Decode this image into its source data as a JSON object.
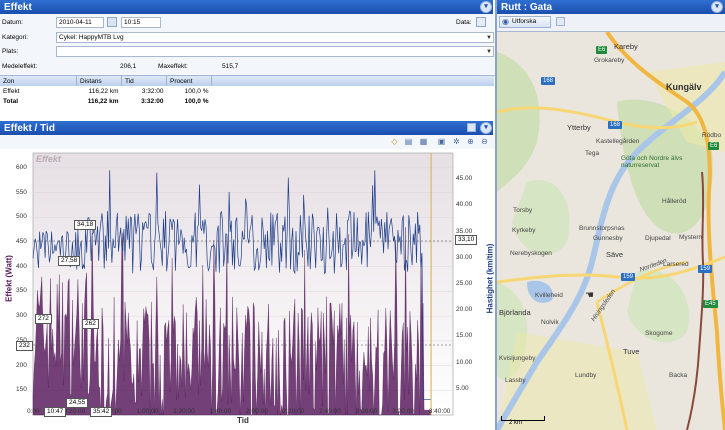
{
  "effekt_panel": {
    "title": "Effekt",
    "datum_label": "Datum:",
    "datum_value": "2010-04-11",
    "time_value": "10:15",
    "data_label": "Data:",
    "kategori_label": "Kategori:",
    "kategori_value": "Cykel: HappyMTB Lvg",
    "plats_label": "Plats:",
    "plats_value": "",
    "medel_label": "Medeleffekt:",
    "medel_value": "206,1",
    "max_label": "Maxeffekt:",
    "max_value": "515,7",
    "zone_table": {
      "headers": [
        "Zon",
        "Distans",
        "Tid",
        "Procent"
      ],
      "rows": [
        [
          "Effekt",
          "116,22 km",
          "3:32:00",
          "100,0 %"
        ],
        [
          "Total",
          "116,22 km",
          "3:32:00",
          "100,0 %"
        ]
      ]
    }
  },
  "chart_panel": {
    "title": "Effekt / Tid",
    "chart_watermark": "Effekt"
  },
  "chart_data": {
    "type": "line",
    "title": "",
    "xlabel": "Tid",
    "ylabel": "Effekt (Watt)",
    "y2label": "Hastighet (km/tim)",
    "x_ticks": [
      "0:00",
      "0:20:00",
      "0:40:00",
      "1:00:00",
      "1:20:00",
      "1:40:00",
      "2:00:00",
      "2:20:00",
      "2:40:00",
      "3:00:00",
      "3:20:00",
      "3:40:00"
    ],
    "y_ticks": [
      "600",
      "550",
      "500",
      "450",
      "400",
      "350",
      "300",
      "250",
      "200",
      "150"
    ],
    "y2_ticks": [
      "45.00",
      "40.00",
      "35.00",
      "30.00",
      "25.00",
      "20.00",
      "15.00",
      "10.00",
      "5.00"
    ],
    "xlim_minutes": [
      0,
      230
    ],
    "ylim": [
      100,
      630
    ],
    "y2lim": [
      0,
      50
    ],
    "series": [
      {
        "name": "Effekt (Watt)",
        "axis": "left",
        "color": "#5b1f5f"
      },
      {
        "name": "Hastighet (km/tim)",
        "axis": "right",
        "color": "#1f3f8a"
      }
    ],
    "callouts": {
      "speed_peak": "34,18",
      "speed_avg_left": "27,58",
      "speed_avg_right": "33,10",
      "power_left_1": "272",
      "power_left_2": "232",
      "power_mid": "262",
      "power_bottom": "24,55",
      "time_start": "10:47",
      "time_end": "35:42"
    },
    "end_marker_minutes": 218
  },
  "map_panel": {
    "title": "Rutt : Gata",
    "utforska_label": "Utforska",
    "scale_label": "2 km",
    "places": [
      "Kareby",
      "Grokareby",
      "Kungälv",
      "Ytterby",
      "Göta och Nordre älvs naturreservat",
      "Kastellegården",
      "Tega",
      "Torsby",
      "Hålleröd",
      "Kyrkeby",
      "Brunnstorpsnas",
      "Gunnesby",
      "Djupedal",
      "Mystern",
      "Nerebyskogen",
      "Säve",
      "Larsered",
      "Kvilleheid",
      "Nolvik",
      "Björlanda",
      "Skogome",
      "Tuve",
      "Kvisljungeby",
      "Lundby",
      "Backa",
      "Lassby",
      "Norrleden",
      "Hisingsleden",
      "Rödbo"
    ],
    "road_shields": [
      "E6",
      "168",
      "168",
      "159",
      "159",
      "E6",
      "E45"
    ]
  },
  "colors": {
    "title_blue": "#1a4fae",
    "power_fill": "#5b1f5f",
    "speed_line": "#1f3f8a",
    "chart_bg_top": "#e8e2e6"
  }
}
